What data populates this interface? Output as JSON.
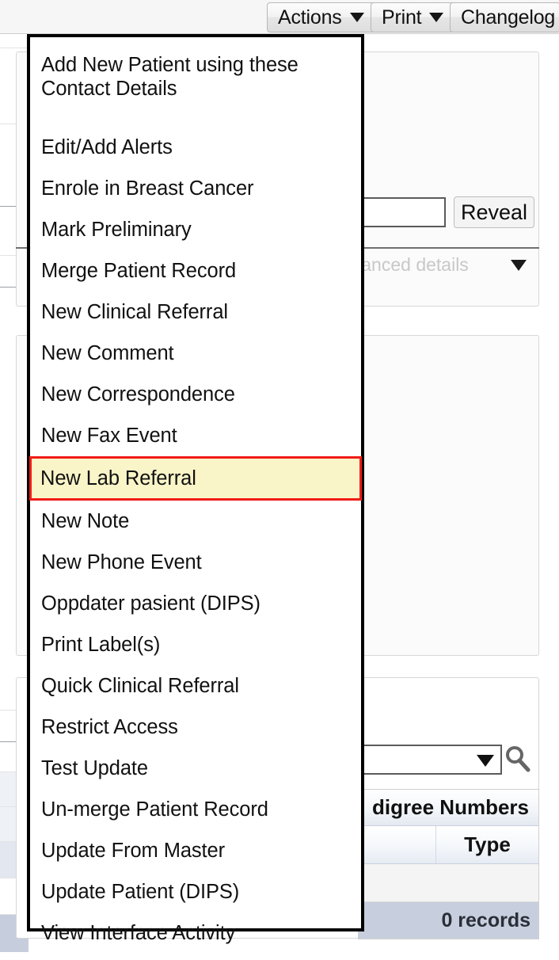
{
  "toolbar": {
    "buttons": [
      {
        "label": "Actions",
        "has_caret": true,
        "icon": "chevron-down-icon"
      },
      {
        "label": "Print",
        "has_caret": true,
        "icon": "chevron-down-icon"
      },
      {
        "label": "Changelog",
        "has_caret": false,
        "icon": ""
      }
    ]
  },
  "background": {
    "reveal_button": "Reveal",
    "advanced_details_label": "e advanced details",
    "advanced_details_icon": "chevron-down-icon",
    "search_icon": "search-icon",
    "combo_caret_icon": "chevron-down-icon",
    "grid": {
      "title": "digree Numbers",
      "columns": [
        "",
        "Type"
      ],
      "rows": [],
      "footer": "0 records"
    }
  },
  "menu": {
    "name": "actions-dropdown-menu",
    "highlight_color": "#faf5c8",
    "highlight_border_color": "#f01c18",
    "items": [
      {
        "label": "Add New Patient using these Contact Details",
        "wraps": true,
        "highlighted": false
      },
      {
        "label": "Edit/Add Alerts",
        "wraps": false,
        "highlighted": false
      },
      {
        "label": "Enrole in Breast Cancer",
        "wraps": false,
        "highlighted": false
      },
      {
        "label": "Mark Preliminary",
        "wraps": false,
        "highlighted": false
      },
      {
        "label": "Merge Patient Record",
        "wraps": false,
        "highlighted": false
      },
      {
        "label": "New Clinical Referral",
        "wraps": false,
        "highlighted": false
      },
      {
        "label": "New Comment",
        "wraps": false,
        "highlighted": false
      },
      {
        "label": "New Correspondence",
        "wraps": false,
        "highlighted": false
      },
      {
        "label": "New Fax Event",
        "wraps": false,
        "highlighted": false
      },
      {
        "label": "New Lab Referral",
        "wraps": false,
        "highlighted": true
      },
      {
        "label": "New Note",
        "wraps": false,
        "highlighted": false
      },
      {
        "label": "New Phone Event",
        "wraps": false,
        "highlighted": false
      },
      {
        "label": "Oppdater pasient (DIPS)",
        "wraps": false,
        "highlighted": false
      },
      {
        "label": "Print Label(s)",
        "wraps": false,
        "highlighted": false
      },
      {
        "label": "Quick Clinical Referral",
        "wraps": false,
        "highlighted": false
      },
      {
        "label": "Restrict Access",
        "wraps": false,
        "highlighted": false
      },
      {
        "label": "Test Update",
        "wraps": false,
        "highlighted": false
      },
      {
        "label": "Un-merge Patient Record",
        "wraps": false,
        "highlighted": false
      },
      {
        "label": "Update From Master",
        "wraps": false,
        "highlighted": false
      },
      {
        "label": "Update Patient (DIPS)",
        "wraps": false,
        "highlighted": false
      },
      {
        "label": "View Interface Activity",
        "wraps": false,
        "highlighted": false
      }
    ]
  }
}
